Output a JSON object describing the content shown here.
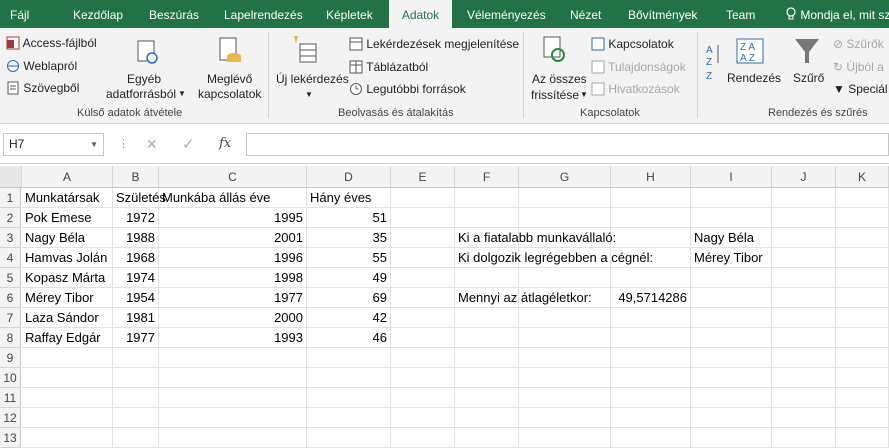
{
  "tabs": [
    "Fájl",
    "Kezdőlap",
    "Beszúrás",
    "Lapelrendezés",
    "Képletek",
    "Adatok",
    "Véleményezés",
    "Nézet",
    "Bővítmények",
    "Team"
  ],
  "tell_me": "Mondja el, mit sz",
  "ribbon": {
    "access": "Access-fájlból",
    "web": "Weblapról",
    "text": "Szövegből",
    "other_1": "Egyéb",
    "other_2": "adatforrásból",
    "existing_1": "Meglévő",
    "existing_2": "kapcsolatok",
    "group_external": "Külső adatok átvétele",
    "new_query": "Új lekérdezés",
    "show_queries": "Lekérdezések megjelenítése",
    "from_table": "Táblázatból",
    "recent": "Legutóbbi források",
    "group_get": "Beolvasás és átalakítás",
    "refresh_1": "Az összes",
    "refresh_2": "frissítése",
    "connections": "Kapcsolatok",
    "properties": "Tulajdonságok",
    "edit_links": "Hivatkozások",
    "group_conn": "Kapcsolatok",
    "sort": "Rendezés",
    "filter": "Szűrő",
    "clear": "Szűrők",
    "reapply": "Újból a",
    "advanced": "Speciál",
    "group_sort": "Rendezés és szűrés"
  },
  "formula_bar": {
    "name_box": "H7",
    "fx": "fx",
    "formula": ""
  },
  "columns": [
    "A",
    "B",
    "C",
    "D",
    "E",
    "F",
    "G",
    "H",
    "I",
    "J",
    "K"
  ],
  "rows": [
    "1",
    "2",
    "3",
    "4",
    "5",
    "6",
    "7",
    "8",
    "9",
    "10",
    "11",
    "12",
    "13"
  ],
  "table": {
    "headers": [
      "Munkatársak",
      "Születés",
      "Munkába állás éve",
      "Hány éves"
    ],
    "rows": [
      [
        "Pok Emese",
        "1972",
        "1995",
        "51"
      ],
      [
        "Nagy Béla",
        "1988",
        "2001",
        "35"
      ],
      [
        "Hamvas Jolán",
        "1968",
        "1996",
        "55"
      ],
      [
        "Kopasz Márta",
        "1974",
        "1998",
        "49"
      ],
      [
        "Mérey Tibor",
        "1954",
        "1977",
        "69"
      ],
      [
        "Laza Sándor",
        "1981",
        "2000",
        "42"
      ],
      [
        "Raffay Edgár",
        "1977",
        "1993",
        "46"
      ]
    ]
  },
  "questions": {
    "youngest_q": "Ki a fiatalabb munkavállaló:",
    "youngest_a": "Nagy Béla",
    "longest_q": "Ki dolgozik legrégebben a cégnél:",
    "longest_a": "Mérey Tibor",
    "avg_q": "Mennyi az átlagéletkor:",
    "avg_a": "49,5714286"
  },
  "colors": {
    "accent": "#217346"
  }
}
